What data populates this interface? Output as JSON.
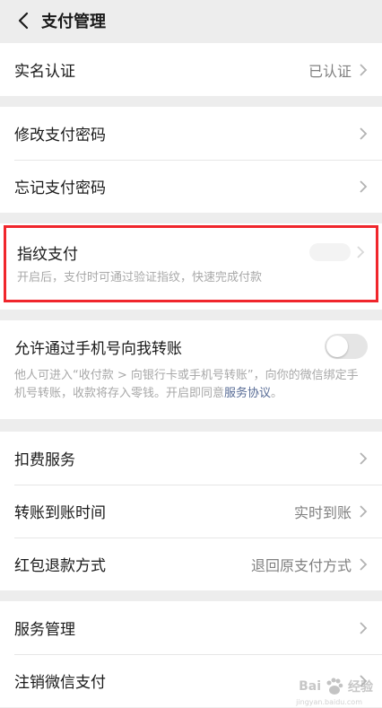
{
  "header": {
    "title": "支付管理"
  },
  "realname": {
    "label": "实名认证",
    "value": "已认证"
  },
  "password": {
    "modify": "修改支付密码",
    "forget": "忘记支付密码"
  },
  "fingerprint": {
    "label": "指纹支付",
    "desc": "开启后，支付时可通过验证指纹，快速完成付款",
    "highlight_color": "#f0262c"
  },
  "phone_transfer": {
    "label": "允许通过手机号向我转账",
    "desc": "他人可进入“收付款 > 向银行卡或手机号转账”，向你的微信绑定手机号转账，收款将存入零钱。开启即同意",
    "link": "服务协议",
    "desc_end": "。",
    "enabled": false
  },
  "services": {
    "deduction": {
      "label": "扣费服务"
    },
    "transfer_time": {
      "label": "转账到账时间",
      "value": "实时到账"
    },
    "redpacket_refund": {
      "label": "红包退款方式",
      "value": "退回原支付方式"
    }
  },
  "manage": {
    "service_manage": "服务管理",
    "cancel_pay": "注销微信支付"
  },
  "watermark": {
    "text": "Bai",
    "text2": "经验",
    "sub": "jingyan.baidu.com"
  },
  "colors": {
    "link": "#576b95",
    "background": "#ededed",
    "muted": "#808080"
  }
}
